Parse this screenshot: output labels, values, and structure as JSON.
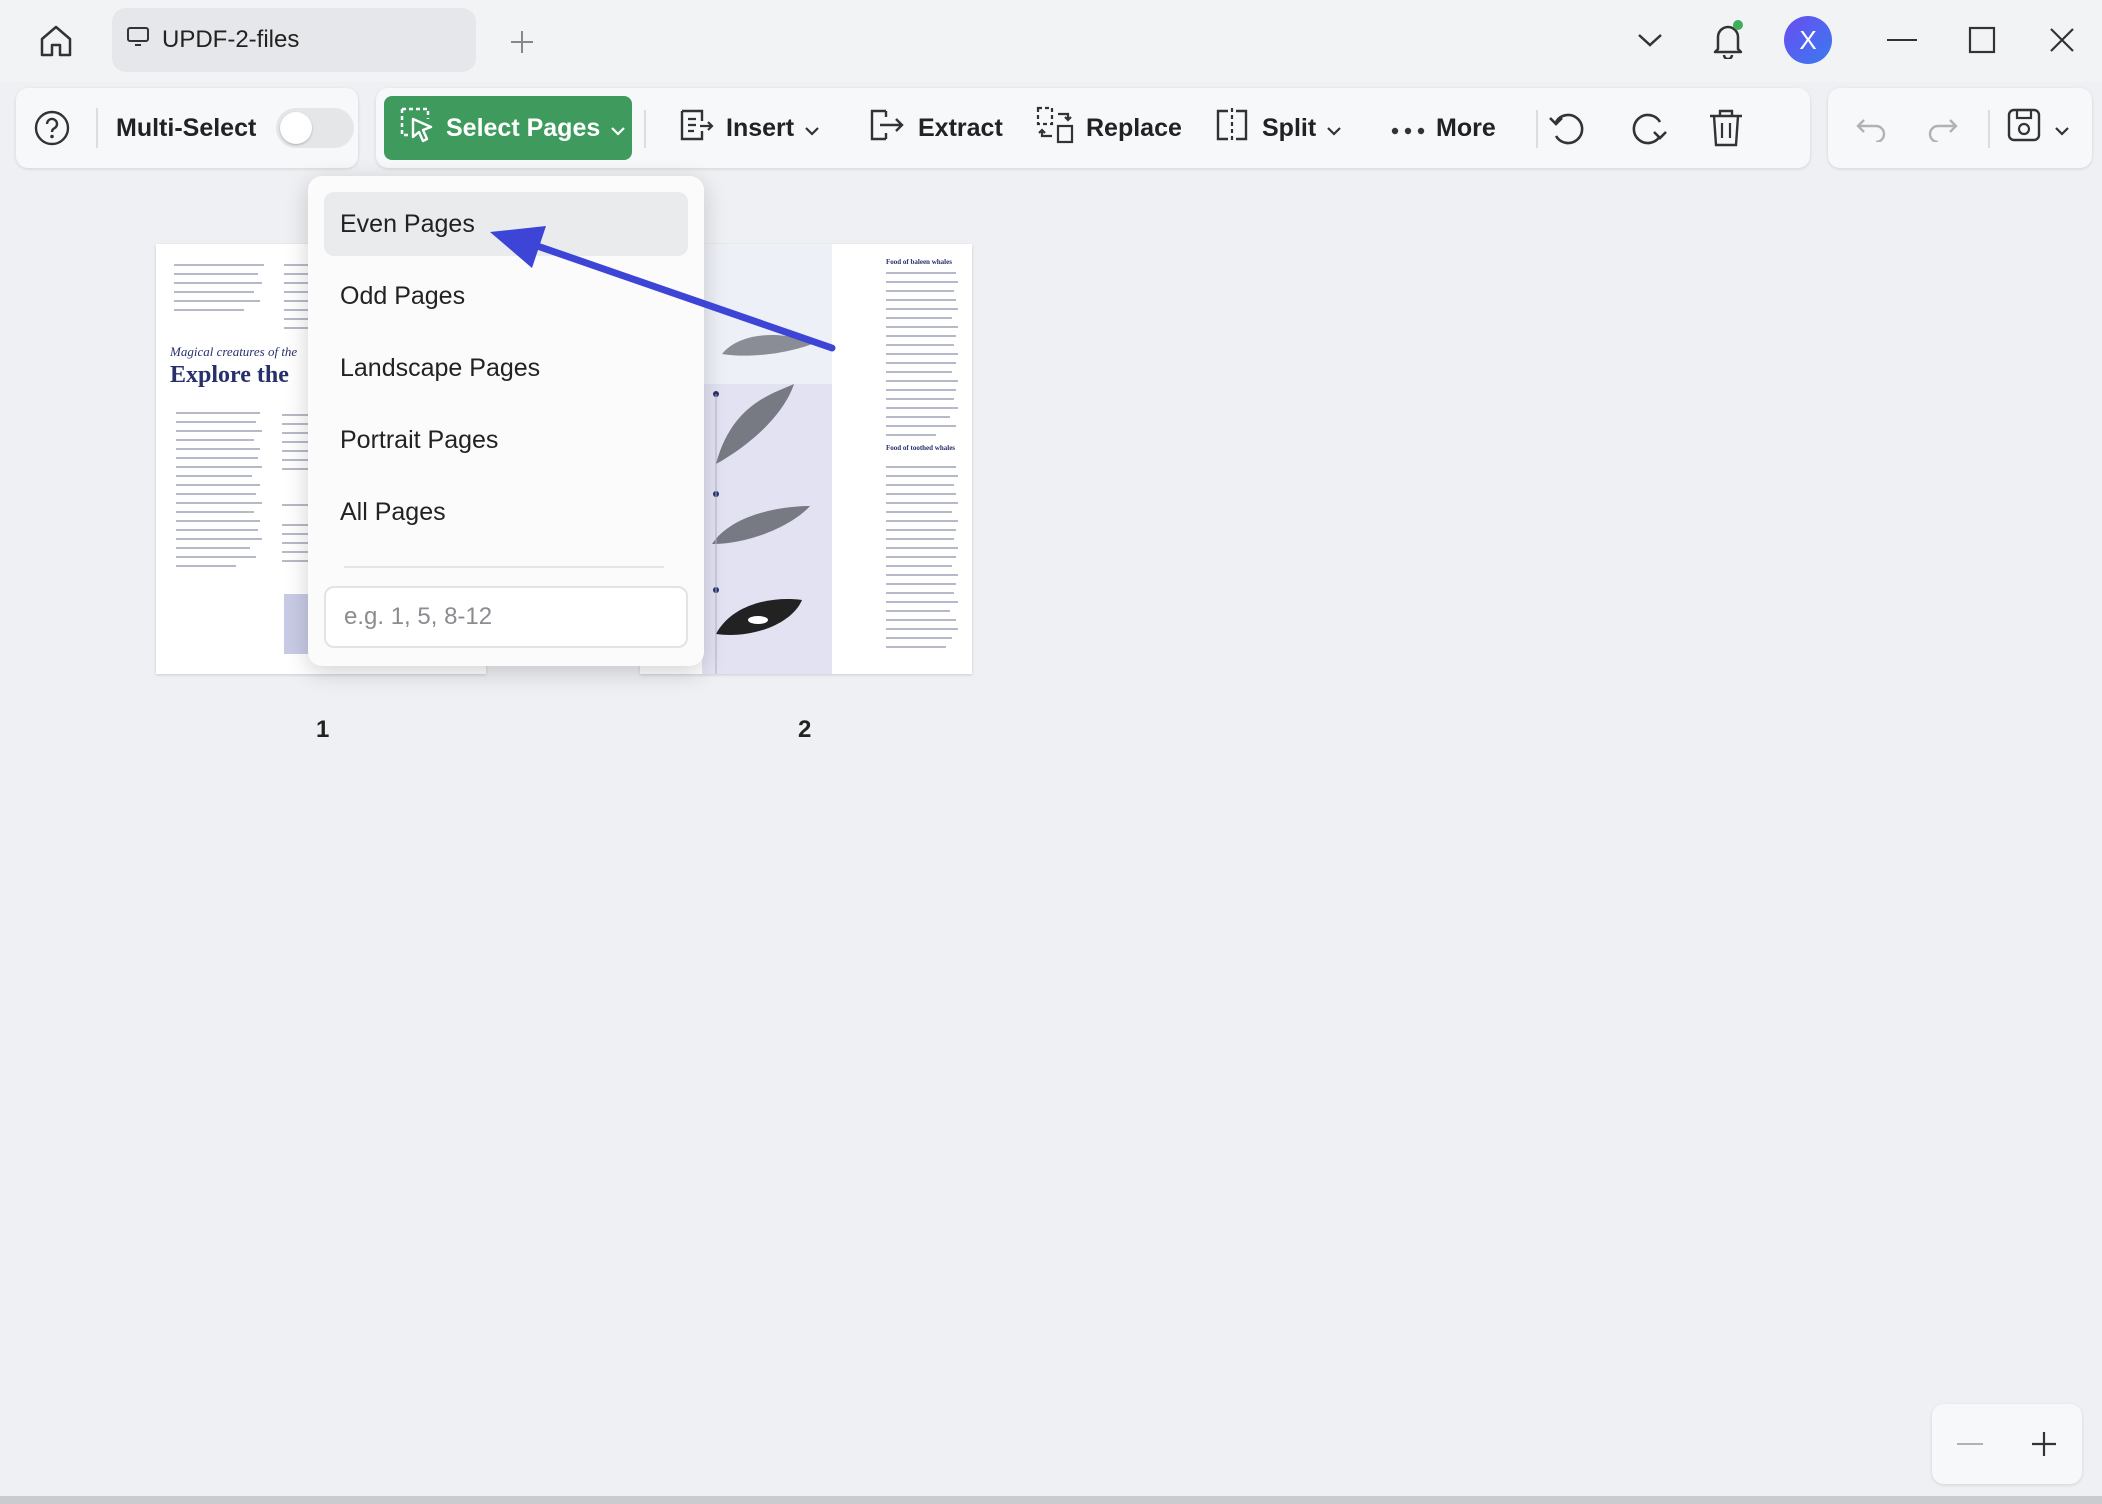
{
  "window": {
    "tab_title": "UPDF-2-files",
    "avatar_letter": "X"
  },
  "toolbar": {
    "multi_select_label": "Multi-Select",
    "multi_select_on": false,
    "select_pages_label": "Select Pages",
    "insert_label": "Insert",
    "extract_label": "Extract",
    "replace_label": "Replace",
    "split_label": "Split",
    "more_label": "More"
  },
  "dropdown": {
    "items": [
      "Even Pages",
      "Odd Pages",
      "Landscape Pages",
      "Portrait Pages",
      "All Pages"
    ],
    "active_item": "Even Pages",
    "range_placeholder": "e.g. 1, 5, 8-12"
  },
  "pages": [
    {
      "number": "1",
      "subtitle": "Magical creatures of the",
      "heading": "Explore the"
    },
    {
      "number": "2",
      "heading_a": "Food of baleen whales",
      "heading_b": "Food of toothed whales"
    }
  ],
  "colors": {
    "accent_green": "#3f9b5d",
    "annotation_arrow": "#3d45d6",
    "page_title_navy": "#27306b"
  }
}
